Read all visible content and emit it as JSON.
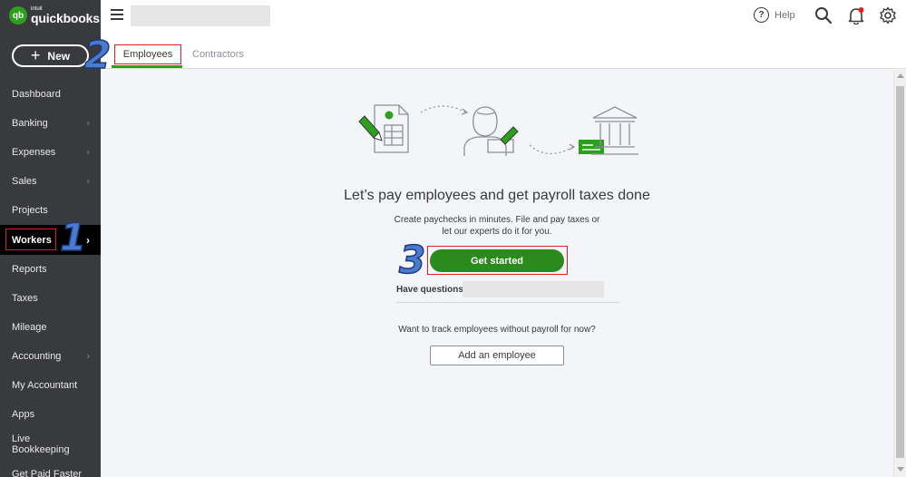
{
  "brand": {
    "intuit": "intuit",
    "name": "quickbooks",
    "mark": "qb",
    "color": "#2ca01c"
  },
  "sidebar": {
    "new_label": "New",
    "items": [
      {
        "label": "Dashboard",
        "chevron": false
      },
      {
        "label": "Banking",
        "chevron": true
      },
      {
        "label": "Expenses",
        "chevron": true
      },
      {
        "label": "Sales",
        "chevron": true
      },
      {
        "label": "Projects",
        "chevron": false
      },
      {
        "label": "Workers",
        "chevron": true,
        "active": true
      },
      {
        "label": "Reports",
        "chevron": false
      },
      {
        "label": "Taxes",
        "chevron": false
      },
      {
        "label": "Mileage",
        "chevron": false
      },
      {
        "label": "Accounting",
        "chevron": true
      },
      {
        "label": "My Accountant",
        "chevron": false
      },
      {
        "label": "Apps",
        "chevron": false
      },
      {
        "label": "Live Bookkeeping",
        "chevron": false
      },
      {
        "label": "Get Paid Faster",
        "chevron": false
      }
    ]
  },
  "topbar": {
    "help_label": "Help"
  },
  "tabs": {
    "employees": "Employees",
    "contractors": "Contractors"
  },
  "annotations": {
    "one": "1",
    "two": "2",
    "three": "3"
  },
  "main": {
    "headline": "Let’s pay employees and get payroll taxes done",
    "sub_line1": "Create paychecks in minutes. File and pay taxes or",
    "sub_line2": "let our experts do it for you.",
    "get_started": "Get started",
    "have_questions": "Have questions?",
    "track_text": "Want to track employees without payroll for now?",
    "add_employee": "Add an employee"
  }
}
